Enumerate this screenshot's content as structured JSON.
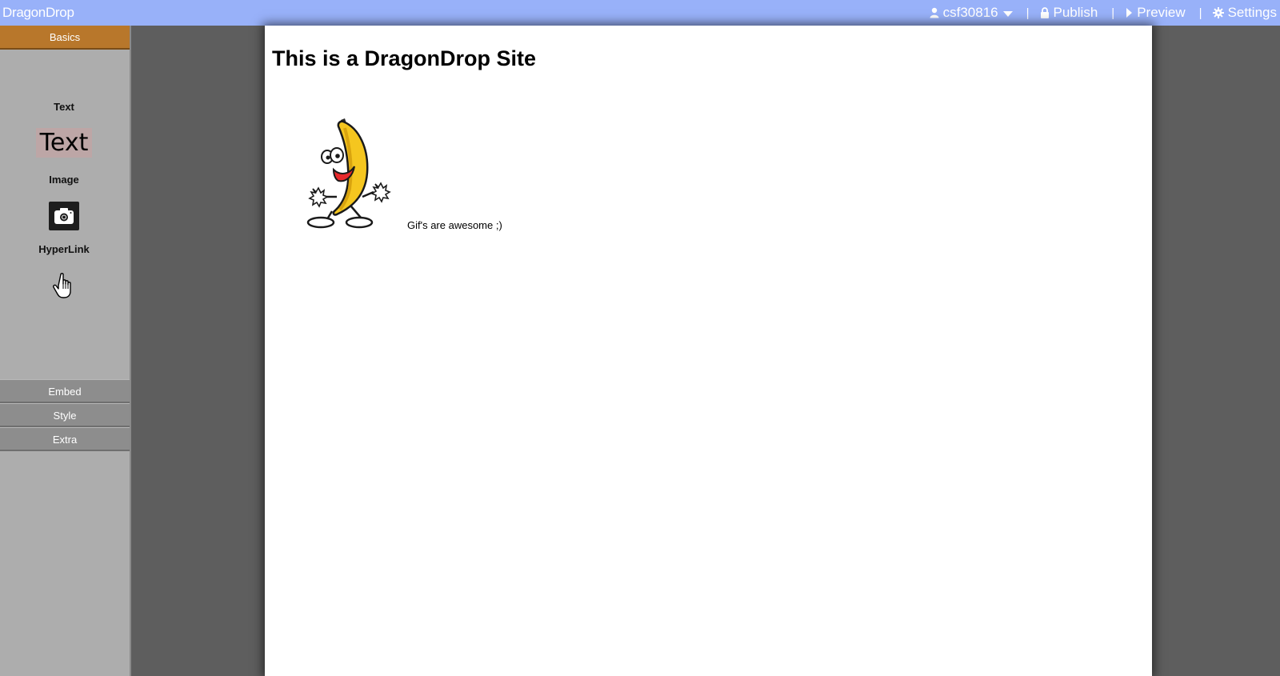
{
  "app": {
    "brand": "DragonDrop"
  },
  "topbar": {
    "user": "csf30816",
    "separator": "|",
    "publish": "Publish",
    "preview": "Preview",
    "settings": "Settings",
    "icons": [
      "user-icon",
      "lock-icon",
      "play-icon",
      "gear-icon",
      "chevron-down-icon"
    ]
  },
  "sidebar": {
    "panels": [
      {
        "label": "Basics",
        "active": true
      },
      {
        "label": "Embed",
        "active": false
      },
      {
        "label": "Style",
        "active": false
      },
      {
        "label": "Extra",
        "active": false
      }
    ],
    "tools": {
      "text_label": "Text",
      "text_preview": "Text",
      "image_label": "Image",
      "hyperlink_label": "HyperLink"
    },
    "colors": {
      "active_panel": "#b8772b",
      "sidebar_bg": "#adadad"
    }
  },
  "canvas": {
    "title": "This is a DragonDrop Site",
    "caption": "Gif's are awesome ;)",
    "image_subject": "dancing banana gif"
  },
  "colors": {
    "topbar": "#98b1f9",
    "workspace": "#5e5e5e",
    "page": "#ffffff"
  }
}
